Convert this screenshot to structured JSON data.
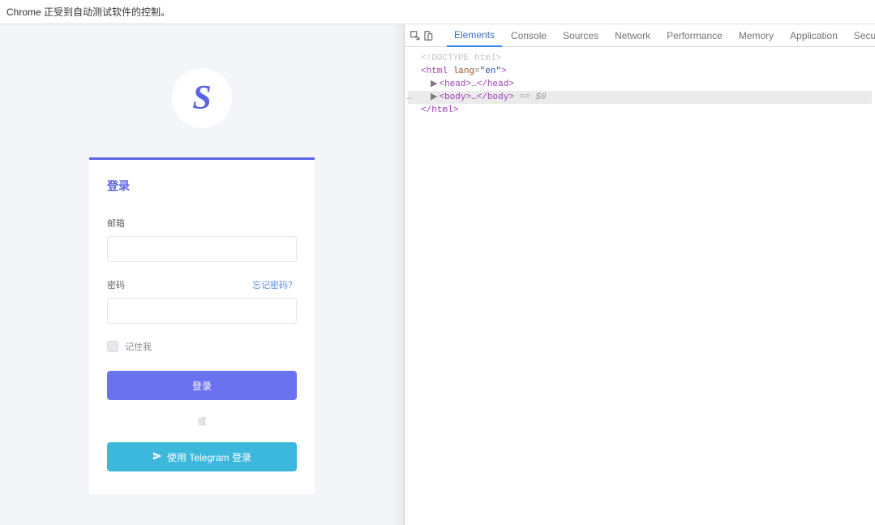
{
  "chrome": {
    "automation_notice": "Chrome 正受到自动测试软件的控制。"
  },
  "page": {
    "logo_letter": "S",
    "login_heading": "登录",
    "email_label": "邮箱",
    "password_label": "密码",
    "forgot_password": "忘记密码？",
    "remember_me": "记住我",
    "login_button": "登录",
    "divider_text": "或",
    "telegram_button": "使用 Telegram 登录"
  },
  "devtools": {
    "tabs": {
      "elements": "Elements",
      "console": "Console",
      "sources": "Sources",
      "network": "Network",
      "performance": "Performance",
      "memory": "Memory",
      "application": "Application",
      "security": "Security"
    },
    "dom": {
      "doctype": "<!DOCTYPE html>",
      "html_open": "<html lang=\"en\">",
      "head": "<head>…</head>",
      "body": "<body>…</body>",
      "selected_suffix": " == $0",
      "html_close": "</html>"
    }
  }
}
